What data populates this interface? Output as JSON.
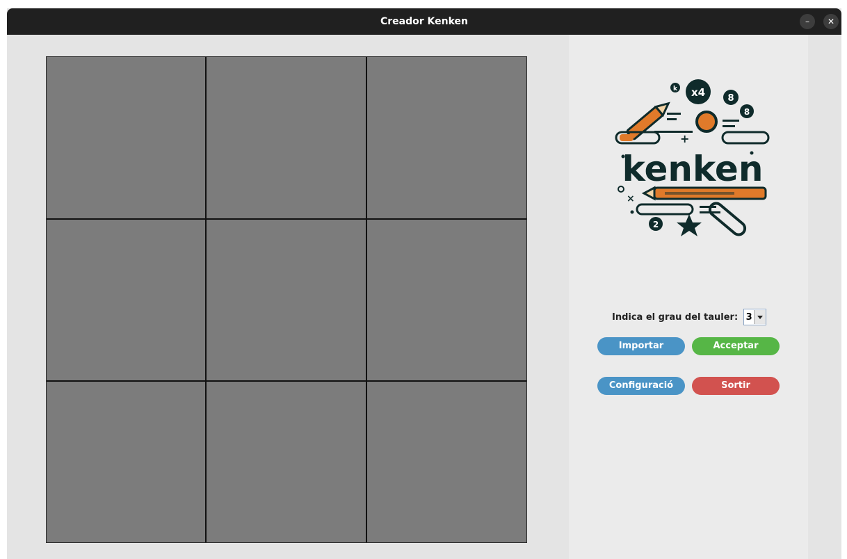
{
  "window": {
    "title": "Creador Kenken",
    "minimize_glyph": "–",
    "close_glyph": "✕"
  },
  "board": {
    "grade": 3,
    "cell_color": "#7c7c7c"
  },
  "logo": {
    "text": "kenken",
    "glyphs": [
      "x4",
      "8",
      "8",
      "k",
      "2",
      "+",
      "×"
    ]
  },
  "controls": {
    "degree_label": "Indica el grau del tauler:",
    "degree_value": "3",
    "buttons": {
      "import": "Importar",
      "accept": "Acceptar",
      "config": "Configuració",
      "exit": "Sortir"
    }
  },
  "colors": {
    "import": "#4a94c6",
    "accept": "#56b646",
    "config": "#4a94c6",
    "exit": "#d2524f"
  }
}
